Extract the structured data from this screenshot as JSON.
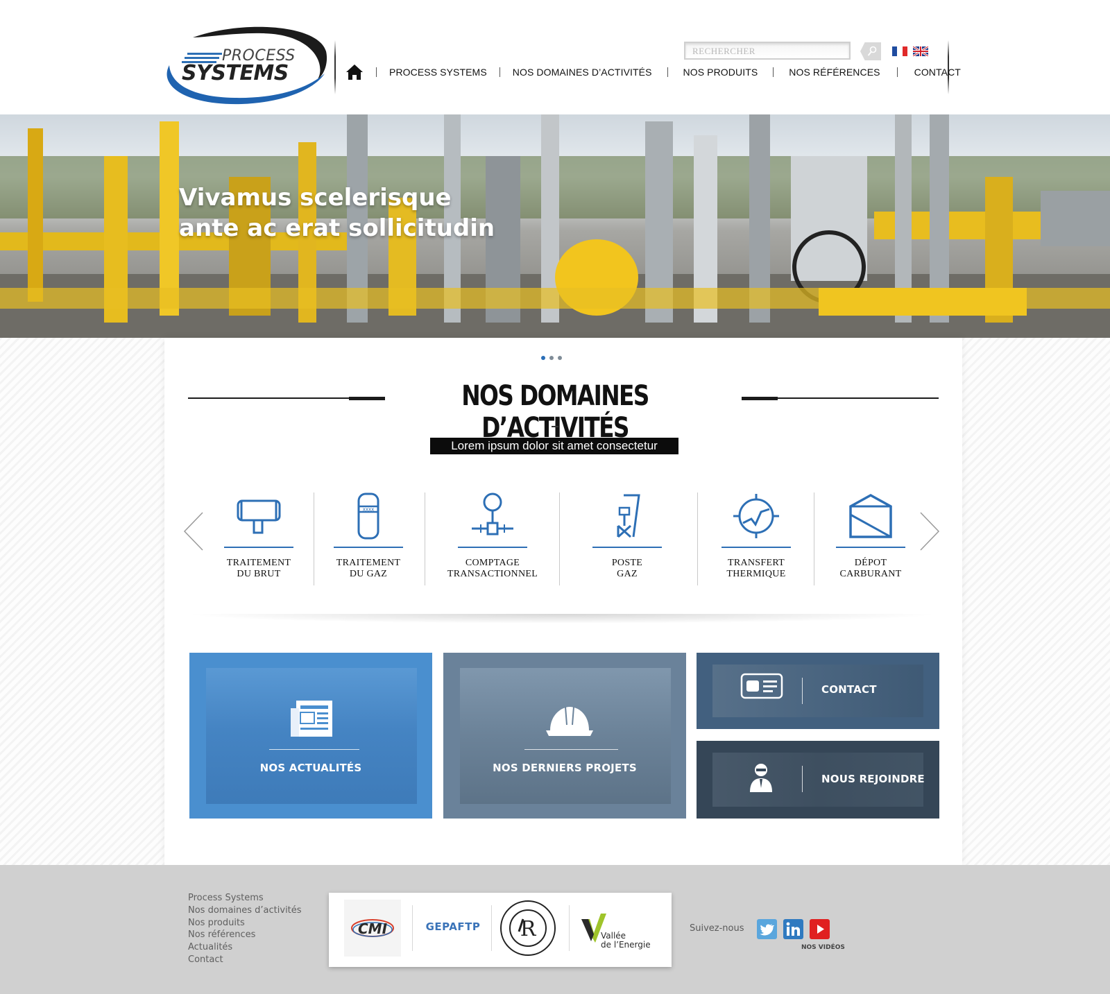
{
  "header": {
    "logo_text_1": "PROCESS",
    "logo_text_2": "SYSTEMS",
    "search_placeholder": "RECHERCHER",
    "languages": [
      "fr-flag-icon",
      "en-flag-icon"
    ],
    "nav": {
      "home_icon": "home-icon",
      "items": [
        "PROCESS SYSTEMS",
        "NOS DOMAINES D’ACTIVITÉS",
        "NOS PRODUITS",
        "NOS RÉFÉRENCES",
        "CONTACT"
      ]
    }
  },
  "hero": {
    "title_line1": "Vivamus scelerisque",
    "title_line2": "ante ac erat sollicitudin",
    "slides_count": 3,
    "active_slide": 1
  },
  "activities": {
    "title": "NOS DOMAINES D’ACTIVITÉS",
    "subtitle": "Lorem ipsum dolor sit amet consectetur",
    "items": [
      {
        "line1": "TRAITEMENT",
        "line2": "DU BRUT",
        "icon": "crude-treatment-icon"
      },
      {
        "line1": "TRAITEMENT",
        "line2": "DU GAZ",
        "icon": "gas-treatment-icon"
      },
      {
        "line1": "COMPTAGE",
        "line2": "TRANSACTIONNEL",
        "icon": "metering-icon"
      },
      {
        "line1": "POSTE",
        "line2": "GAZ",
        "icon": "gas-station-icon"
      },
      {
        "line1": "TRANSFERT",
        "line2": "THERMIQUE",
        "icon": "heat-transfer-icon"
      },
      {
        "line1": "DÉPOT",
        "line2": "CARBURANT",
        "icon": "fuel-depot-icon"
      }
    ]
  },
  "tiles": {
    "news": "NOS ACTUALITÉS",
    "projects": "NOS DERNIERS PROJETS",
    "contact": "CONTACT",
    "join": "NOUS REJOINDRE"
  },
  "colors": {
    "accent_blue": "#2d6fb5",
    "tile_news": "#4a8fcf",
    "tile_projects": "#6a829a",
    "tile_contact": "#42607f",
    "tile_join": "#354657",
    "footer_bg": "#d0d0d0"
  },
  "footer": {
    "links": [
      "Process Systems",
      "Nos domaines d’activités",
      "Nos produits",
      "Nos références",
      "Actualités",
      "Contact"
    ],
    "partners": {
      "cmi": "CMI",
      "gepaftp": "GEPAFTP",
      "lloyds": "LLOYD'S REGISTER QUALITY ASSURANCE ISO9001",
      "vallee_1": "Vallée",
      "vallee_2": "de l’Energie"
    },
    "follow_label": "Suivez-nous",
    "videos_label": "NOS VIDÉOS"
  }
}
